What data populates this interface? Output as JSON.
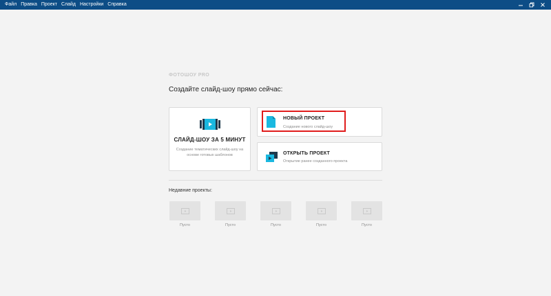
{
  "menu": {
    "items": [
      "Файл",
      "Правка",
      "Проект",
      "Слайд",
      "Настройки",
      "Справка"
    ]
  },
  "window_controls": {
    "minimize_icon": "minimize-icon",
    "restore_icon": "restore-icon",
    "close_icon": "close-icon"
  },
  "app": {
    "logo_text": "ФОТОШОУ PRO"
  },
  "main": {
    "heading": "Создайте слайд-шоу прямо сейчас:",
    "quick_card": {
      "title": "СЛАЙД-ШОУ ЗА 5 МИНУТ",
      "description": "Создание тематических слайд-шоу на основе готовых шаблонов",
      "icon": "filmstrip-play-icon"
    },
    "new_project_card": {
      "title": "НОВЫЙ ПРОЕКТ",
      "description": "Создание нового слайд-шоу",
      "icon": "new-file-icon"
    },
    "open_project_card": {
      "title": "ОТКРЫТЬ ПРОЕКТ",
      "description": "Открытие ранее созданного проекта",
      "icon": "open-project-icon"
    }
  },
  "recent": {
    "heading": "Недавние проекты:",
    "items": [
      {
        "label": "Пусто"
      },
      {
        "label": "Пусто"
      },
      {
        "label": "Пусто"
      },
      {
        "label": "Пусто"
      },
      {
        "label": "Пусто"
      }
    ]
  },
  "colors": {
    "titlebar": "#0d4d86",
    "accent": "#1ab8e0",
    "highlight": "#e01b1b",
    "background": "#f3f3f3"
  }
}
